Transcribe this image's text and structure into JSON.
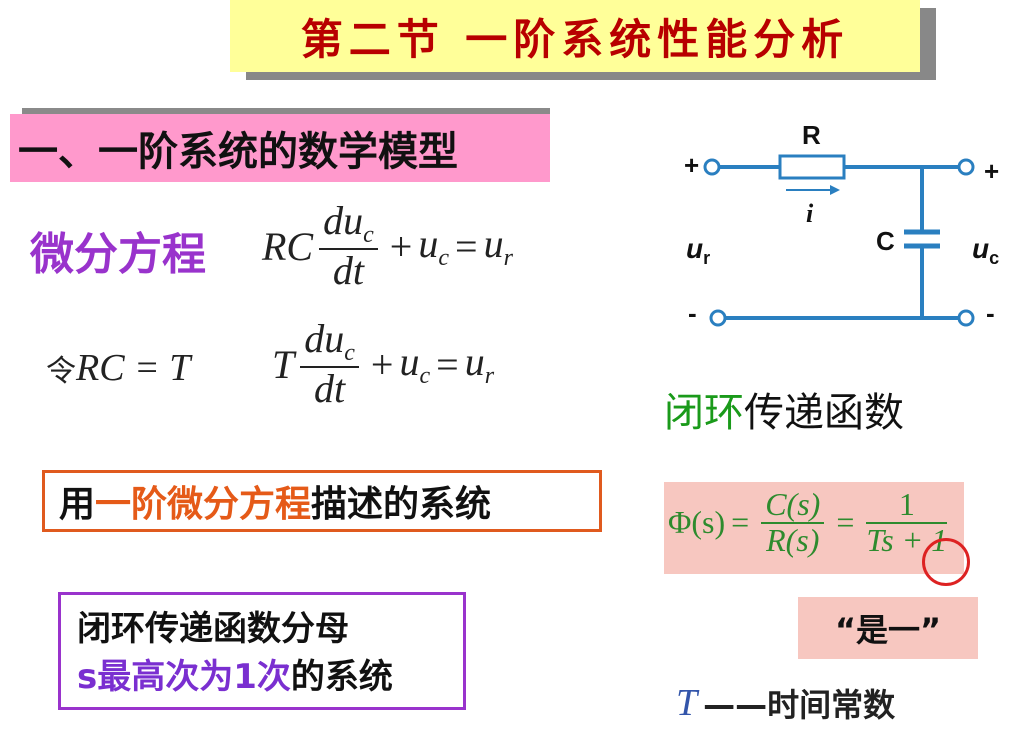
{
  "title": "第二节  一阶系统性能分析",
  "subtitle": "一、一阶系统的数学模型",
  "diff_eq_label": "微分方程",
  "eq1": {
    "lhs_prefix": "RC",
    "num": "du",
    "num_sub": "c",
    "den": "dt",
    "plus": "+",
    "u": "u",
    "u_sub": "c",
    "eq": "=",
    "rhs": "u",
    "rhs_sub": "r"
  },
  "let_eq": {
    "ling": "令",
    "expr": "RC = T"
  },
  "eq2": {
    "lhs_prefix": "T",
    "num": "du",
    "num_sub": "c",
    "den": "dt",
    "plus": "+",
    "u": "u",
    "u_sub": "c",
    "eq": "=",
    "rhs": "u",
    "rhs_sub": "r"
  },
  "desc1": {
    "pre": "用",
    "highlight": "一阶微分方程",
    "post": "描述的系统"
  },
  "desc2": {
    "line1": "闭环传递函数分母",
    "hl": "s最高次为1次",
    "post": "的系统"
  },
  "circuit": {
    "r_label": "R",
    "i_label": "i",
    "c_label": "C",
    "ur": "u",
    "ur_sub": "r",
    "uc": "u",
    "uc_sub": "c",
    "plus": "+",
    "minus": "-"
  },
  "tf_title": {
    "green": "闭环",
    "black": "传递函数"
  },
  "tf": {
    "phi": "Φ(s)",
    "eq": "=",
    "num1": "C(s)",
    "den1": "R(s)",
    "num2": "1",
    "den2": "Ts + 1"
  },
  "quote": "“是一”",
  "time_const": {
    "t": "T",
    "text": "——时间常数"
  },
  "colors": {
    "title": "#b80000",
    "title_bg": "#ffff99",
    "subtitle_bg": "#ff99cc",
    "purple": "#9933cc",
    "orange": "#e55a18",
    "green": "#2e8b2e",
    "circuit": "#2a7fc0"
  }
}
